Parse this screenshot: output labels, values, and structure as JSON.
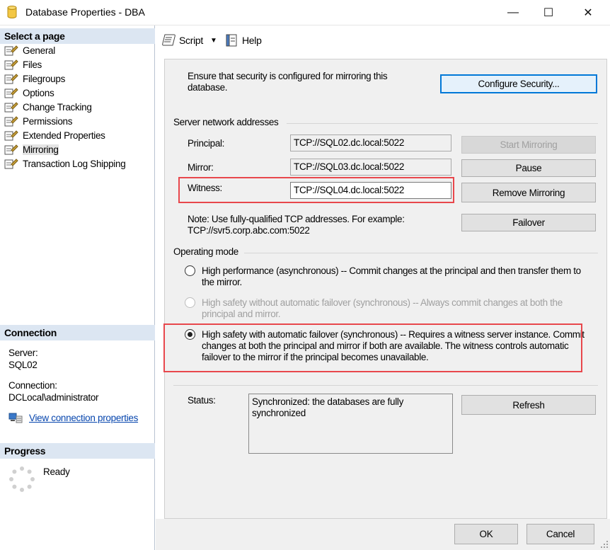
{
  "window": {
    "title": "Database Properties - DBA",
    "minimize": "—",
    "maximize": "☐",
    "close": "✕"
  },
  "left": {
    "select_page_header": "Select a page",
    "pages": [
      {
        "label": "General"
      },
      {
        "label": "Files"
      },
      {
        "label": "Filegroups"
      },
      {
        "label": "Options"
      },
      {
        "label": "Change Tracking"
      },
      {
        "label": "Permissions"
      },
      {
        "label": "Extended Properties"
      },
      {
        "label": "Mirroring",
        "selected": true
      },
      {
        "label": "Transaction Log Shipping"
      }
    ],
    "connection_header": "Connection",
    "server_label": "Server:",
    "server_value": "SQL02",
    "connection_label": "Connection:",
    "connection_value": "DCLocal\\administrator",
    "view_connection_link": "View connection properties",
    "progress_header": "Progress",
    "progress_status": "Ready"
  },
  "toolbar": {
    "script_label": "Script",
    "help_label": "Help"
  },
  "mirroring": {
    "security_note": "Ensure that security is configured for mirroring this database.",
    "configure_security_button": "Configure Security...",
    "server_network_header": "Server network addresses",
    "principal_label": "Principal:",
    "principal_value": "TCP://SQL02.dc.local:5022",
    "mirror_label": "Mirror:",
    "mirror_value": "TCP://SQL03.dc.local:5022",
    "witness_label": "Witness:",
    "witness_value": "TCP://SQL04.dc.local:5022",
    "start_mirroring_button": "Start Mirroring",
    "pause_button": "Pause",
    "remove_mirroring_button": "Remove Mirroring",
    "failover_button": "Failover",
    "note_text": "Note: Use fully-qualified TCP addresses. For example: TCP://svr5.corp.abc.com:5022",
    "operating_mode_header": "Operating mode",
    "mode_high_performance": "High performance (asynchronous) -- Commit changes at the principal and then transfer them to the mirror.",
    "mode_high_safety_no_failover": "High safety without automatic failover (synchronous) -- Always commit changes at both the principal and mirror.",
    "mode_high_safety_auto_failover": "High safety with automatic failover (synchronous) -- Requires a witness server instance. Commit changes at both the principal and mirror if both are available. The witness controls automatic failover to the mirror if the principal becomes unavailable.",
    "selected_mode": "high_safety_auto_failover",
    "status_label": "Status:",
    "status_value": "Synchronized: the databases are fully synchronized",
    "refresh_button": "Refresh"
  },
  "footer": {
    "ok_button": "OK",
    "cancel_button": "Cancel"
  },
  "colors": {
    "highlight_border": "#e8474c",
    "section_header_bg": "#dce6f2",
    "default_button_border": "#0078d7",
    "link": "#0645ad"
  }
}
